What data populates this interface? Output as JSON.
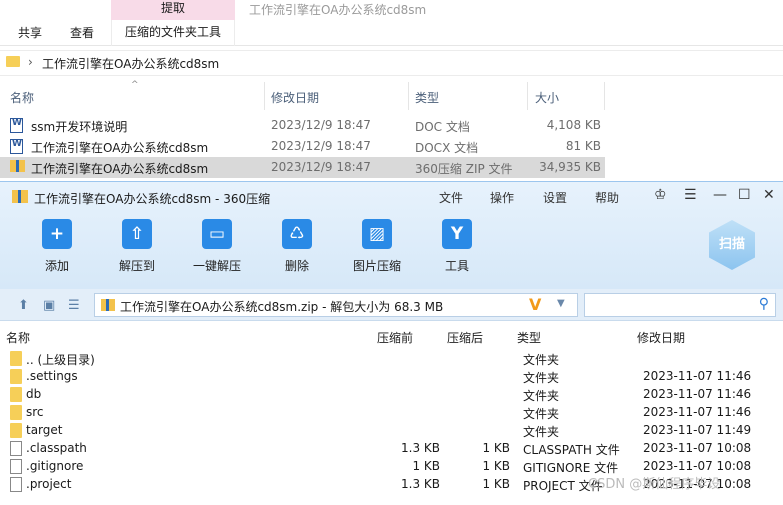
{
  "explorer": {
    "ribbon": {
      "tab_share": "共享",
      "tab_view": "查看",
      "context_extract": "提取",
      "context_tools": "压缩的文件夹工具",
      "window_title": "工作流引擎在OA办公系统cd8sm"
    },
    "address_path": "工作流引擎在OA办公系统cd8sm",
    "columns": {
      "name": "名称",
      "date": "修改日期",
      "type": "类型",
      "size": "大小"
    },
    "files": [
      {
        "name": "ssm开发环境说明",
        "date": "2023/12/9 18:47",
        "type": "DOC 文档",
        "size": "4,108 KB"
      },
      {
        "name": "工作流引擎在OA办公系统cd8sm",
        "date": "2023/12/9 18:47",
        "type": "DOCX 文档",
        "size": "81 KB"
      },
      {
        "name": "工作流引擎在OA办公系统cd8sm",
        "date": "2023/12/9 18:47",
        "type": "360压缩 ZIP 文件",
        "size": "34,935 KB"
      }
    ]
  },
  "archiver": {
    "title": "工作流引擎在OA办公系统cd8sm - 360压缩",
    "menu": [
      "文件",
      "操作",
      "设置",
      "帮助"
    ],
    "toolbar": [
      {
        "label": "添加",
        "icon": "add-icon"
      },
      {
        "label": "解压到",
        "icon": "extract-icon"
      },
      {
        "label": "一键解压",
        "icon": "one-click-extract-icon"
      },
      {
        "label": "删除",
        "icon": "delete-icon"
      },
      {
        "label": "图片压缩",
        "icon": "image-compress-icon"
      },
      {
        "label": "工具",
        "icon": "tools-icon"
      }
    ],
    "scan_label": "扫描",
    "path_text": "工作流引擎在OA办公系统cd8sm.zip - 解包大小为 68.3 MB",
    "columns": {
      "name": "名称",
      "compressed": "压缩前",
      "after": "压缩后",
      "type": "类型",
      "modified": "修改日期"
    },
    "rows": [
      {
        "name": ".. (上级目录)",
        "before": "",
        "after": "",
        "type": "文件夹",
        "date": ""
      },
      {
        "name": ".settings",
        "before": "",
        "after": "",
        "type": "文件夹",
        "date": "2023-11-07 11:46"
      },
      {
        "name": "db",
        "before": "",
        "after": "",
        "type": "文件夹",
        "date": "2023-11-07 11:46"
      },
      {
        "name": "src",
        "before": "",
        "after": "",
        "type": "文件夹",
        "date": "2023-11-07 11:46"
      },
      {
        "name": "target",
        "before": "",
        "after": "",
        "type": "文件夹",
        "date": "2023-11-07 11:49"
      },
      {
        "name": ".classpath",
        "before": "1.3 KB",
        "after": "1 KB",
        "type": "CLASSPATH 文件",
        "date": "2023-11-07 10:08"
      },
      {
        "name": ".gitignore",
        "before": "1 KB",
        "after": "1 KB",
        "type": "GITIGNORE 文件",
        "date": "2023-11-07 10:08"
      },
      {
        "name": ".project",
        "before": "1.3 KB",
        "after": "1 KB",
        "type": "PROJECT 文件",
        "date": "2023-11-07 10:08"
      }
    ]
  },
  "watermark": "CSDN @斯仙程序毕设"
}
